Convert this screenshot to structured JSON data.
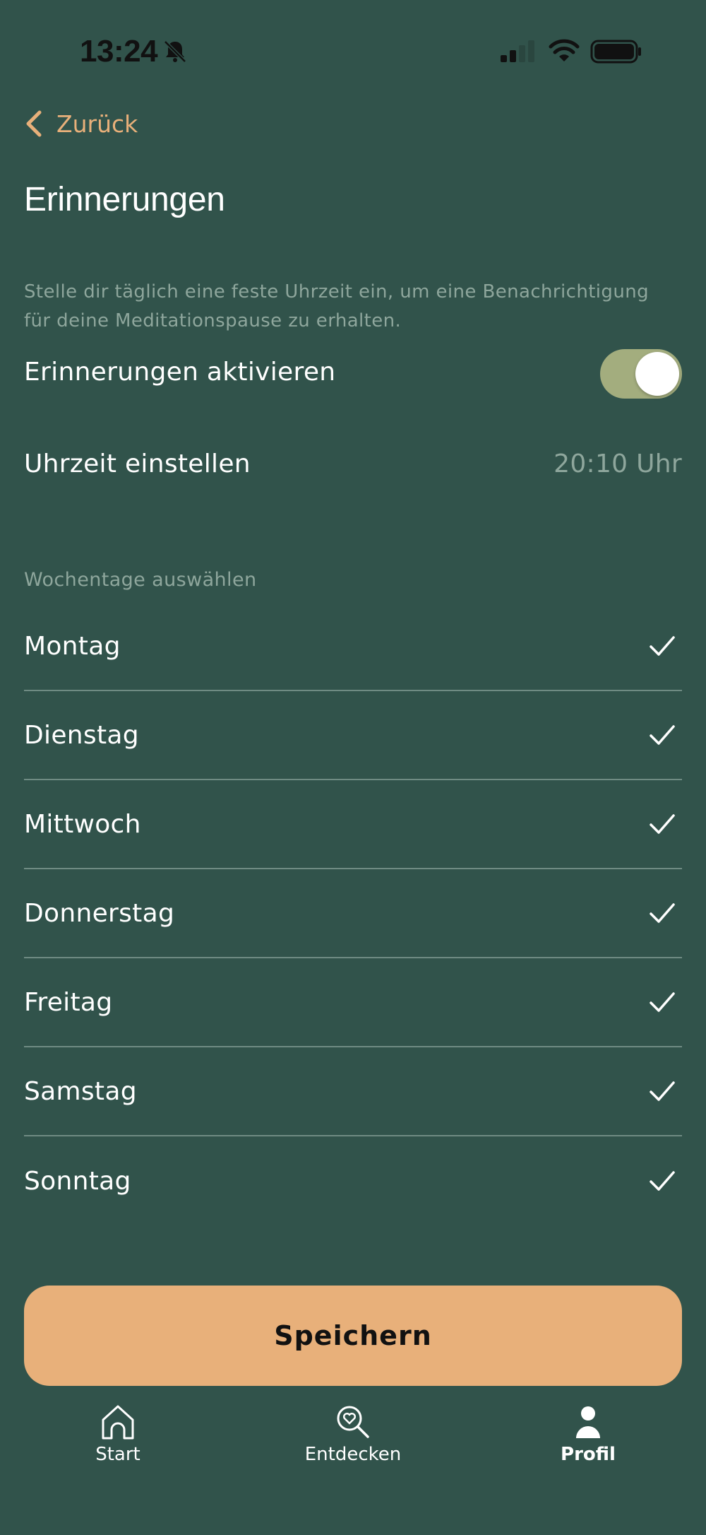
{
  "status_bar": {
    "time": "13:24"
  },
  "nav": {
    "back_label": "Zurück"
  },
  "page": {
    "title": "Erinnerungen",
    "description": "Stelle dir täglich eine feste Uhrzeit ein, um eine Benachrichtigung für deine Meditationspause zu erhalten."
  },
  "reminders": {
    "enable_label": "Erinnerungen aktivieren",
    "enabled": true,
    "time_label": "Uhrzeit einstellen",
    "time_value": "20:10 Uhr"
  },
  "weekdays": {
    "section_label": "Wochentage auswählen",
    "days": [
      {
        "label": "Montag",
        "checked": true
      },
      {
        "label": "Dienstag",
        "checked": true
      },
      {
        "label": "Mittwoch",
        "checked": true
      },
      {
        "label": "Donnerstag",
        "checked": true
      },
      {
        "label": "Freitag",
        "checked": true
      },
      {
        "label": "Samstag",
        "checked": true
      },
      {
        "label": "Sonntag",
        "checked": true
      }
    ]
  },
  "actions": {
    "save_label": "Speichern"
  },
  "tab_bar": {
    "tabs": [
      {
        "label": "Start",
        "icon": "home-icon",
        "active": false
      },
      {
        "label": "Entdecken",
        "icon": "discover-icon",
        "active": false
      },
      {
        "label": "Profil",
        "icon": "profile-icon",
        "active": true
      }
    ]
  },
  "colors": {
    "background": "#31534b",
    "accent": "#e8b07a",
    "toggle_on": "#a3ad7e",
    "muted_text": "#8ea69c"
  }
}
